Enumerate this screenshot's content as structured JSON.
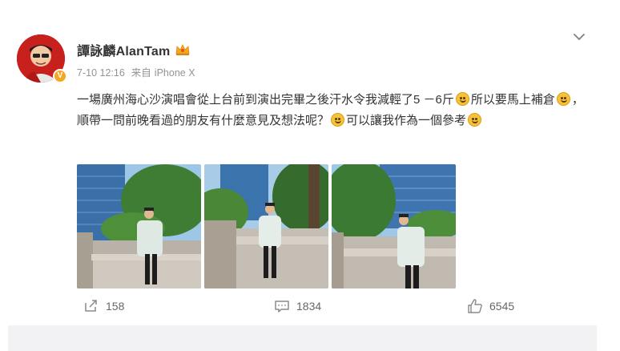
{
  "post": {
    "author_name": "譚詠麟AlanTam",
    "timestamp": "7-10 12:16",
    "source_label": "来自",
    "device": "iPhone X",
    "text_segments": {
      "p1": "一場廣州海心沙演唱會從上台前到演出完畢之後汗水令我減輕了5 －6斤",
      "p2": "所以要馬上補倉",
      "p3": "，順帶一問前晚看過的朋友有什麼意見及想法呢？",
      "p4": "可以讓我作為一個參考"
    },
    "photo_count": 3
  },
  "actions": {
    "repost_count": "158",
    "comment_count": "1834",
    "like_count": "6545"
  },
  "icons": {
    "avatar": "avatar",
    "verified": "verified-badge-icon",
    "crown": "crown-icon",
    "menu": "chevron-down-icon",
    "repost": "repost-icon",
    "comment": "comment-icon",
    "like": "thumbs-up-icon",
    "emoji": "emoji-icon"
  },
  "colors": {
    "text": "#333333",
    "meta": "#939393",
    "action": "#666666",
    "verified": "#f5a623",
    "footer": "#f2f2f5"
  }
}
